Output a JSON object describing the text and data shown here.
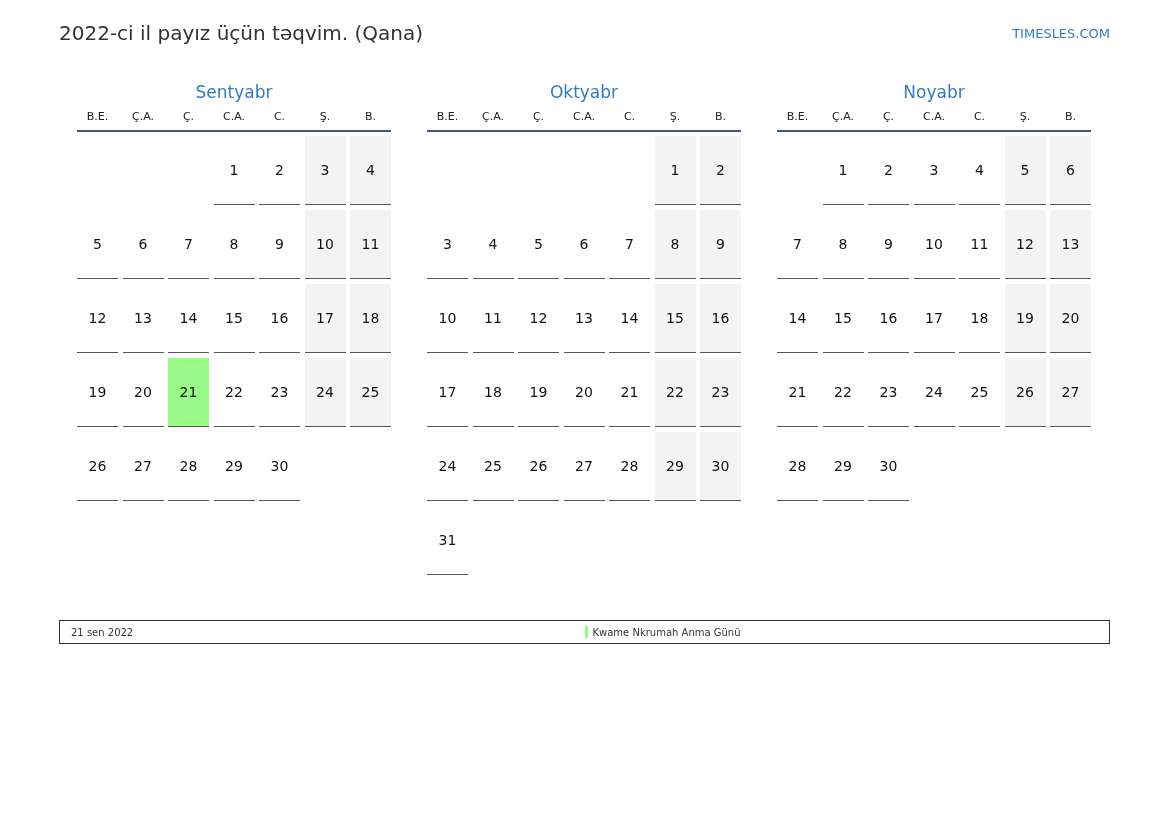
{
  "title": "2022-ci il payız üçün təqvim. (Qana)",
  "brand": "TIMESLES.COM",
  "months": [
    {
      "name": "Sentyabr",
      "weekdays": [
        {
          "label": "B.E.",
          "weekend": false
        },
        {
          "label": "Ç.A.",
          "weekend": false
        },
        {
          "label": "Ç.",
          "weekend": false
        },
        {
          "label": "C.A.",
          "weekend": false
        },
        {
          "label": "C.",
          "weekend": false
        },
        {
          "label": "Ş.",
          "weekend": true
        },
        {
          "label": "B.",
          "weekend": true
        }
      ],
      "weeks": [
        [
          {
            "kind": "blank"
          },
          {
            "kind": "blank"
          },
          {
            "kind": "blank"
          },
          "1",
          "2",
          "3",
          "4"
        ],
        [
          "5",
          "6",
          "7",
          "8",
          "9",
          "10",
          "11"
        ],
        [
          "12",
          "13",
          "14",
          "15",
          "16",
          "17",
          "18"
        ],
        [
          "19",
          "20",
          {
            "day": "21",
            "color": "#98fb88"
          },
          "22",
          "23",
          "24",
          "25"
        ],
        [
          "26",
          "27",
          "28",
          "29",
          "30"
        ]
      ]
    },
    {
      "name": "Oktyabr",
      "weekdays": [
        {
          "label": "B.E.",
          "weekend": false
        },
        {
          "label": "Ç.A.",
          "weekend": false
        },
        {
          "label": "Ç.",
          "weekend": false
        },
        {
          "label": "C.A.",
          "weekend": false
        },
        {
          "label": "C.",
          "weekend": false
        },
        {
          "label": "Ş.",
          "weekend": true
        },
        {
          "label": "B.",
          "weekend": true
        }
      ],
      "weeks": [
        [
          {
            "kind": "blank"
          },
          {
            "kind": "blank"
          },
          {
            "kind": "blank"
          },
          {
            "kind": "blank"
          },
          {
            "kind": "blank"
          },
          "1",
          "2"
        ],
        [
          "3",
          "4",
          "5",
          "6",
          "7",
          "8",
          "9"
        ],
        [
          "10",
          "11",
          "12",
          "13",
          "14",
          "15",
          "16"
        ],
        [
          "17",
          "18",
          "19",
          "20",
          "21",
          "22",
          "23"
        ],
        [
          "24",
          "25",
          "26",
          "27",
          "28",
          "29",
          "30"
        ],
        [
          "31"
        ]
      ]
    },
    {
      "name": "Noyabr",
      "weekdays": [
        {
          "label": "B.E.",
          "weekend": false
        },
        {
          "label": "Ç.A.",
          "weekend": false
        },
        {
          "label": "Ç.",
          "weekend": false
        },
        {
          "label": "C.A.",
          "weekend": false
        },
        {
          "label": "C.",
          "weekend": false
        },
        {
          "label": "Ş.",
          "weekend": true
        },
        {
          "label": "B.",
          "weekend": true
        }
      ],
      "weeks": [
        [
          {
            "kind": "blank"
          },
          "1",
          "2",
          "3",
          "4",
          "5",
          "6"
        ],
        [
          "7",
          "8",
          "9",
          "10",
          "11",
          "12",
          "13"
        ],
        [
          "14",
          "15",
          "16",
          "17",
          "18",
          "19",
          "20"
        ],
        [
          "21",
          "22",
          "23",
          "24",
          "25",
          "26",
          "27"
        ],
        [
          "28",
          "29",
          "30"
        ]
      ]
    }
  ],
  "legend": [
    {
      "date": "21 sen 2022",
      "name": "Kwame Nkrumah Anma Günü",
      "color": "#98fb88"
    }
  ]
}
